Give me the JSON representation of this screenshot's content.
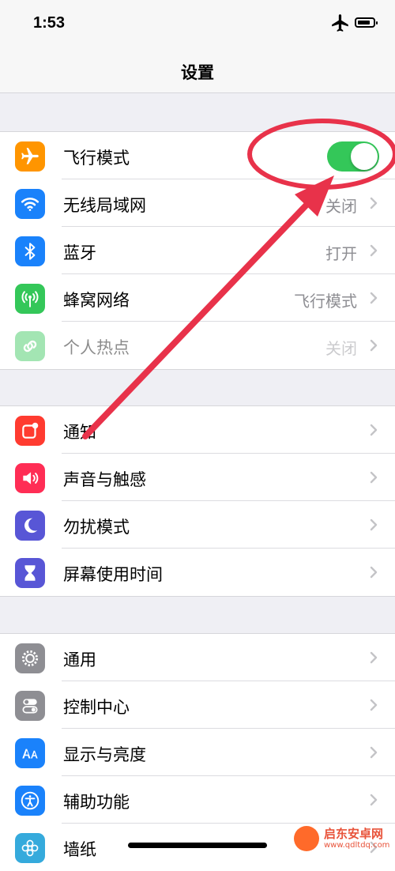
{
  "status_bar": {
    "time": "1:53"
  },
  "nav": {
    "title": "设置"
  },
  "groups": [
    {
      "rows": [
        {
          "label": "飞行模式",
          "icon": "airplane-icon",
          "color": "#ff9500",
          "toggle": true
        },
        {
          "label": "无线局域网",
          "value": "关闭",
          "icon": "wifi-icon",
          "color": "#1a82fb"
        },
        {
          "label": "蓝牙",
          "value": "打开",
          "icon": "bluetooth-icon",
          "color": "#1a82fb"
        },
        {
          "label": "蜂窝网络",
          "value": "飞行模式",
          "icon": "cellular-icon",
          "color": "#34c759"
        },
        {
          "label": "个人热点",
          "value": "关闭",
          "icon": "hotspot-icon",
          "color": "#34c759",
          "disabled": true
        }
      ]
    },
    {
      "rows": [
        {
          "label": "通知",
          "icon": "notifications-icon",
          "color": "#ff3b30"
        },
        {
          "label": "声音与触感",
          "icon": "sound-icon",
          "color": "#ff2d55"
        },
        {
          "label": "勿扰模式",
          "icon": "moon-icon",
          "color": "#5856d6"
        },
        {
          "label": "屏幕使用时间",
          "icon": "hourglass-icon",
          "color": "#5856d6"
        }
      ]
    },
    {
      "rows": [
        {
          "label": "通用",
          "icon": "gear-icon",
          "color": "#8e8e93"
        },
        {
          "label": "控制中心",
          "icon": "switches-icon",
          "color": "#8e8e93"
        },
        {
          "label": "显示与亮度",
          "icon": "display-icon",
          "color": "#1a82fb"
        },
        {
          "label": "辅助功能",
          "icon": "accessibility-icon",
          "color": "#1a82fb"
        },
        {
          "label": "墙纸",
          "icon": "wallpaper-icon",
          "color": "#35aadc"
        }
      ]
    }
  ],
  "watermark": {
    "name": "启东安卓网",
    "url": "www.qdltdq.com"
  },
  "colors": {
    "toggle_on": "#34c759",
    "annotation": "#e8324a"
  }
}
